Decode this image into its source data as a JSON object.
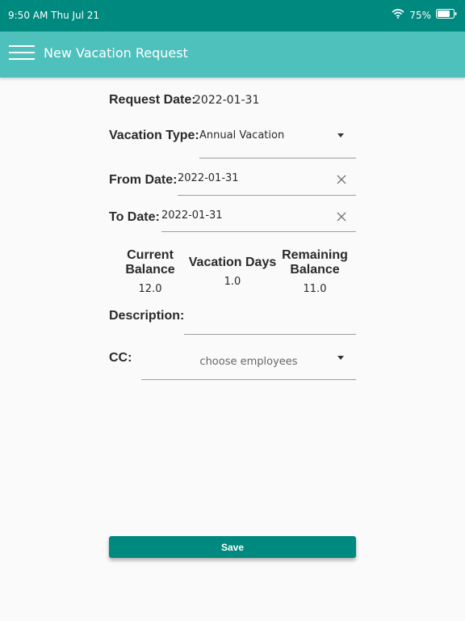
{
  "status_bar": {
    "time_date": "9:50 AM  Thu Jul 21",
    "battery": "75%",
    "icons": [
      "wifi-icon",
      "battery-icon"
    ]
  },
  "app_bar": {
    "title": "New Vacation Request",
    "icon": "menu-icon"
  },
  "form": {
    "request_date_label": "Request Date:",
    "request_date_value": "2022-01-31",
    "vacation_type_label": "Vacation Type:",
    "vacation_type_value": "Annual  Vacation",
    "from_date_label": "From Date:",
    "from_date_value": "2022-01-31",
    "to_date_label": "To Date:",
    "to_date_value": "2022-01-31",
    "description_label": "Description:",
    "description_value": "",
    "cc_label": "CC:",
    "cc_placeholder": "choose employees"
  },
  "balance": {
    "current_line1": "Current",
    "current_line2": "Balance",
    "current_value": "12.0",
    "days_label": "Vacation Days",
    "days_value": "1.0",
    "remaining_line1": "Remaining",
    "remaining_line2": "Balance",
    "remaining_value": "11.0"
  },
  "actions": {
    "save_label": "Save"
  },
  "colors": {
    "status_bar": "#00897f",
    "app_bar": "#4ec1bd",
    "save_button": "#00897f"
  }
}
